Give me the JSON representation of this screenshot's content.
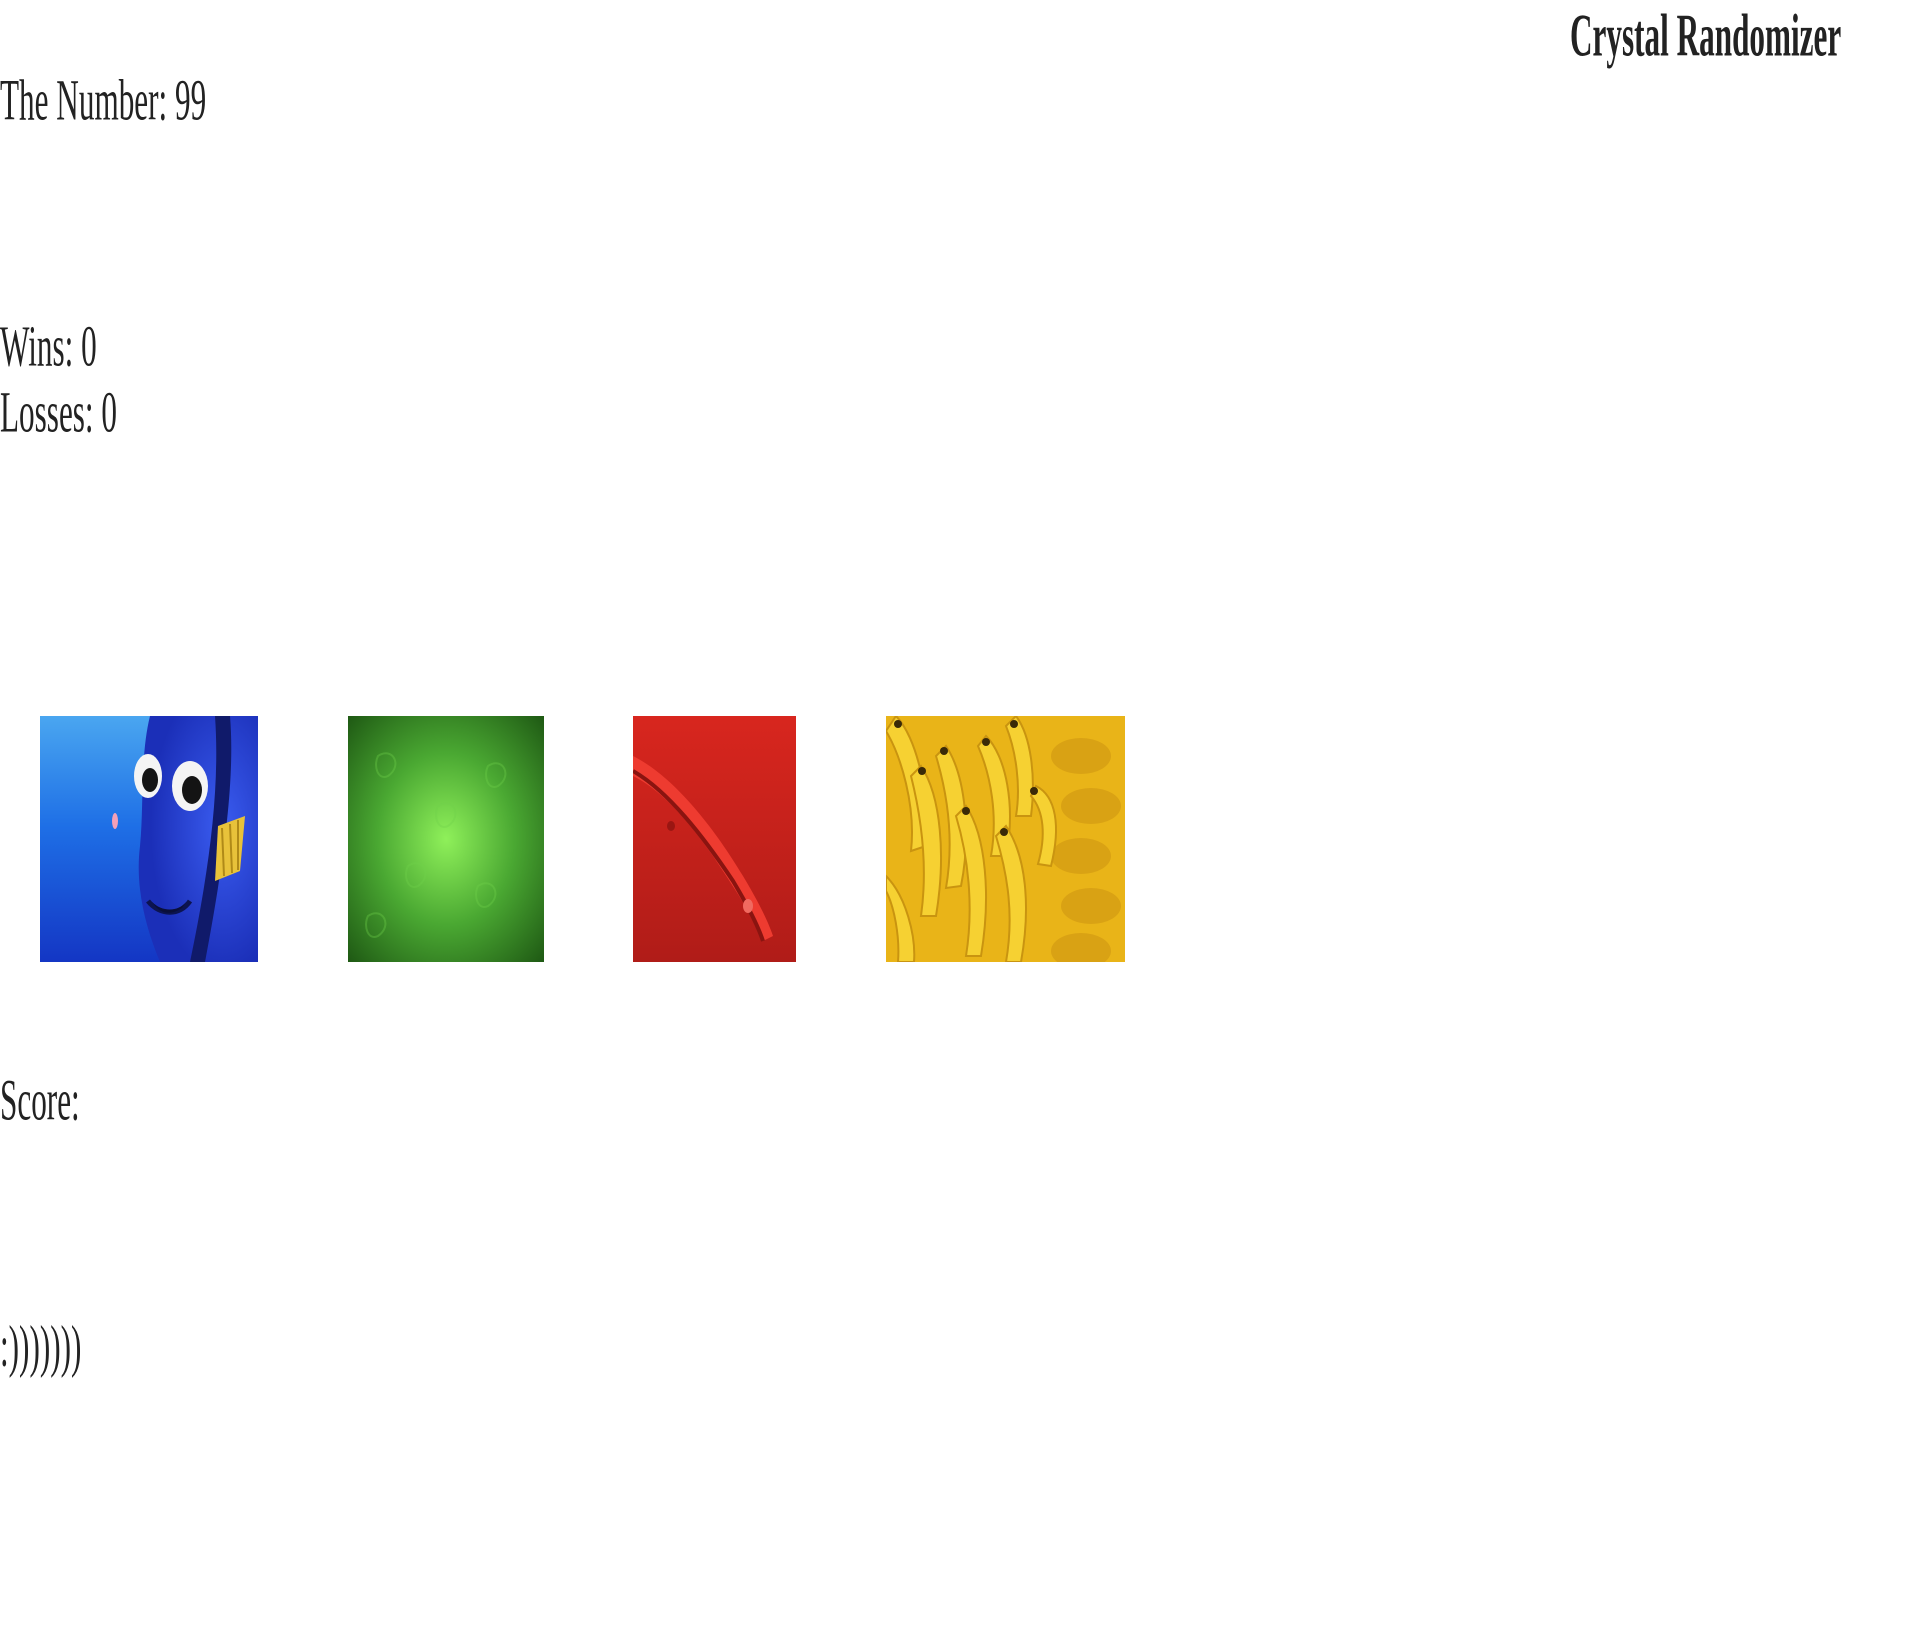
{
  "header": {
    "title": "Crystal Randomizer"
  },
  "game": {
    "target_label": "The Number: 99",
    "wins_label": "Wins: 0",
    "losses_label": "Losses: 0",
    "score_label": "Score:",
    "message": ":)))))))"
  },
  "crystals": [
    {
      "name": "blue fish crystal",
      "icon": "blue-fish-image",
      "color": "#1f5fe0"
    },
    {
      "name": "green crystal",
      "icon": "green-texture-image",
      "color": "#4aa832"
    },
    {
      "name": "red crystal",
      "icon": "red-texture-image",
      "color": "#cf2a22"
    },
    {
      "name": "yellow banana crystal",
      "icon": "banana-bunch-image",
      "color": "#f2c21c"
    }
  ]
}
